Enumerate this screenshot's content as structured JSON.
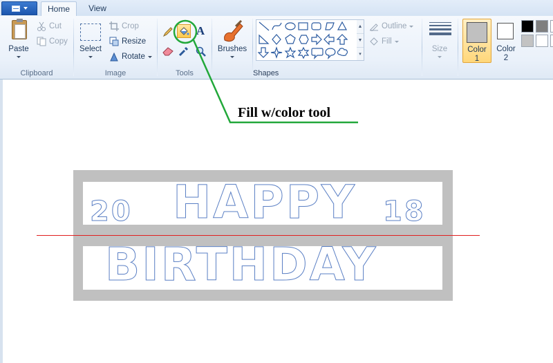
{
  "tabs": {
    "home": "Home",
    "view": "View"
  },
  "clipboard": {
    "group_label": "Clipboard",
    "paste": "Paste",
    "cut": "Cut",
    "copy": "Copy"
  },
  "image": {
    "group_label": "Image",
    "select": "Select",
    "crop": "Crop",
    "resize": "Resize",
    "rotate": "Rotate"
  },
  "tools": {
    "group_label": "Tools",
    "brushes": "Brushes"
  },
  "shapes": {
    "group_label": "Shapes",
    "outline": "Outline",
    "fill": "Fill"
  },
  "size": {
    "label": "Size"
  },
  "colors": {
    "color1_label": "Color",
    "color1_num": "1",
    "color2_label": "Color",
    "color2_num": "2",
    "color1_value": "#c0c0c0",
    "color2_value": "#ffffff",
    "palette": [
      "#000000",
      "#7f7f7f",
      "#ffffff",
      "#c3c3c3",
      "#ffffff",
      "#ffffff"
    ]
  },
  "canvas": {
    "annotation": "Fill w/color tool",
    "line1": {
      "left_number": "20",
      "word": "HAPPY",
      "right_number": "18"
    },
    "line2": {
      "word": "BIRTHDAY"
    },
    "banner_color": "#c0c0c0",
    "guide_line_color": "#e02020",
    "highlight_color": "#22a83a"
  }
}
